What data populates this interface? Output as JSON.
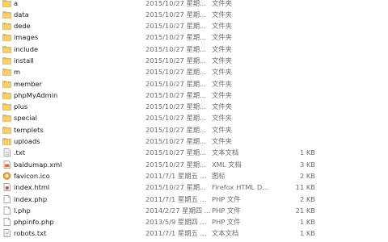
{
  "files": [
    {
      "name": "a",
      "date": "2015/10/27 星期...",
      "type": "文件夹",
      "size": "",
      "icon": "folder-icon"
    },
    {
      "name": "data",
      "date": "2015/10/27 星期...",
      "type": "文件夹",
      "size": "",
      "icon": "folder-icon"
    },
    {
      "name": "dede",
      "date": "2015/10/27 星期...",
      "type": "文件夹",
      "size": "",
      "icon": "folder-icon"
    },
    {
      "name": "images",
      "date": "2015/10/27 星期...",
      "type": "文件夹",
      "size": "",
      "icon": "folder-icon"
    },
    {
      "name": "include",
      "date": "2015/10/27 星期...",
      "type": "文件夹",
      "size": "",
      "icon": "folder-icon"
    },
    {
      "name": "install",
      "date": "2015/10/27 星期...",
      "type": "文件夹",
      "size": "",
      "icon": "folder-icon"
    },
    {
      "name": "m",
      "date": "2015/10/27 星期...",
      "type": "文件夹",
      "size": "",
      "icon": "folder-icon"
    },
    {
      "name": "member",
      "date": "2015/10/27 星期...",
      "type": "文件夹",
      "size": "",
      "icon": "folder-icon"
    },
    {
      "name": "phpMyAdmin",
      "date": "2015/10/27 星期...",
      "type": "文件夹",
      "size": "",
      "icon": "folder-icon"
    },
    {
      "name": "plus",
      "date": "2015/10/27 星期...",
      "type": "文件夹",
      "size": "",
      "icon": "folder-icon"
    },
    {
      "name": "special",
      "date": "2015/10/27 星期...",
      "type": "文件夹",
      "size": "",
      "icon": "folder-icon"
    },
    {
      "name": "templets",
      "date": "2015/10/27 星期...",
      "type": "文件夹",
      "size": "",
      "icon": "folder-icon"
    },
    {
      "name": "uploads",
      "date": "2015/10/27 星期...",
      "type": "文件夹",
      "size": "",
      "icon": "folder-icon"
    },
    {
      "name": ".txt",
      "date": "2015/10/27 星期...",
      "type": "文本文档",
      "size": "1 KB",
      "icon": "text-file-icon"
    },
    {
      "name": "baidumap.xml",
      "date": "2015/10/27 星期...",
      "type": "XML 文档",
      "size": "3 KB",
      "icon": "xml-file-icon"
    },
    {
      "name": "favicon.ico",
      "date": "2011/7/1 星期五 ...",
      "type": "图标",
      "size": "2 KB",
      "icon": "favicon-file-icon"
    },
    {
      "name": "index.html",
      "date": "2015/10/27 星期...",
      "type": "Firefox HTML D...",
      "size": "11 KB",
      "icon": "html-file-icon"
    },
    {
      "name": "index.php",
      "date": "2011/7/1 星期五 ...",
      "type": "PHP 文件",
      "size": "2 KB",
      "icon": "php-file-icon"
    },
    {
      "name": "l.php",
      "date": "2014/2/27 星期四 ...",
      "type": "PHP 文件",
      "size": "21 KB",
      "icon": "php-file-icon"
    },
    {
      "name": "phpinfo.php",
      "date": "2013/5/9 星期四 ...",
      "type": "PHP 文件",
      "size": "1 KB",
      "icon": "php-file-icon"
    },
    {
      "name": "robots.txt",
      "date": "2011/7/1 星期五 ...",
      "type": "文本文档",
      "size": "1 KB",
      "icon": "text-file-icon"
    }
  ]
}
